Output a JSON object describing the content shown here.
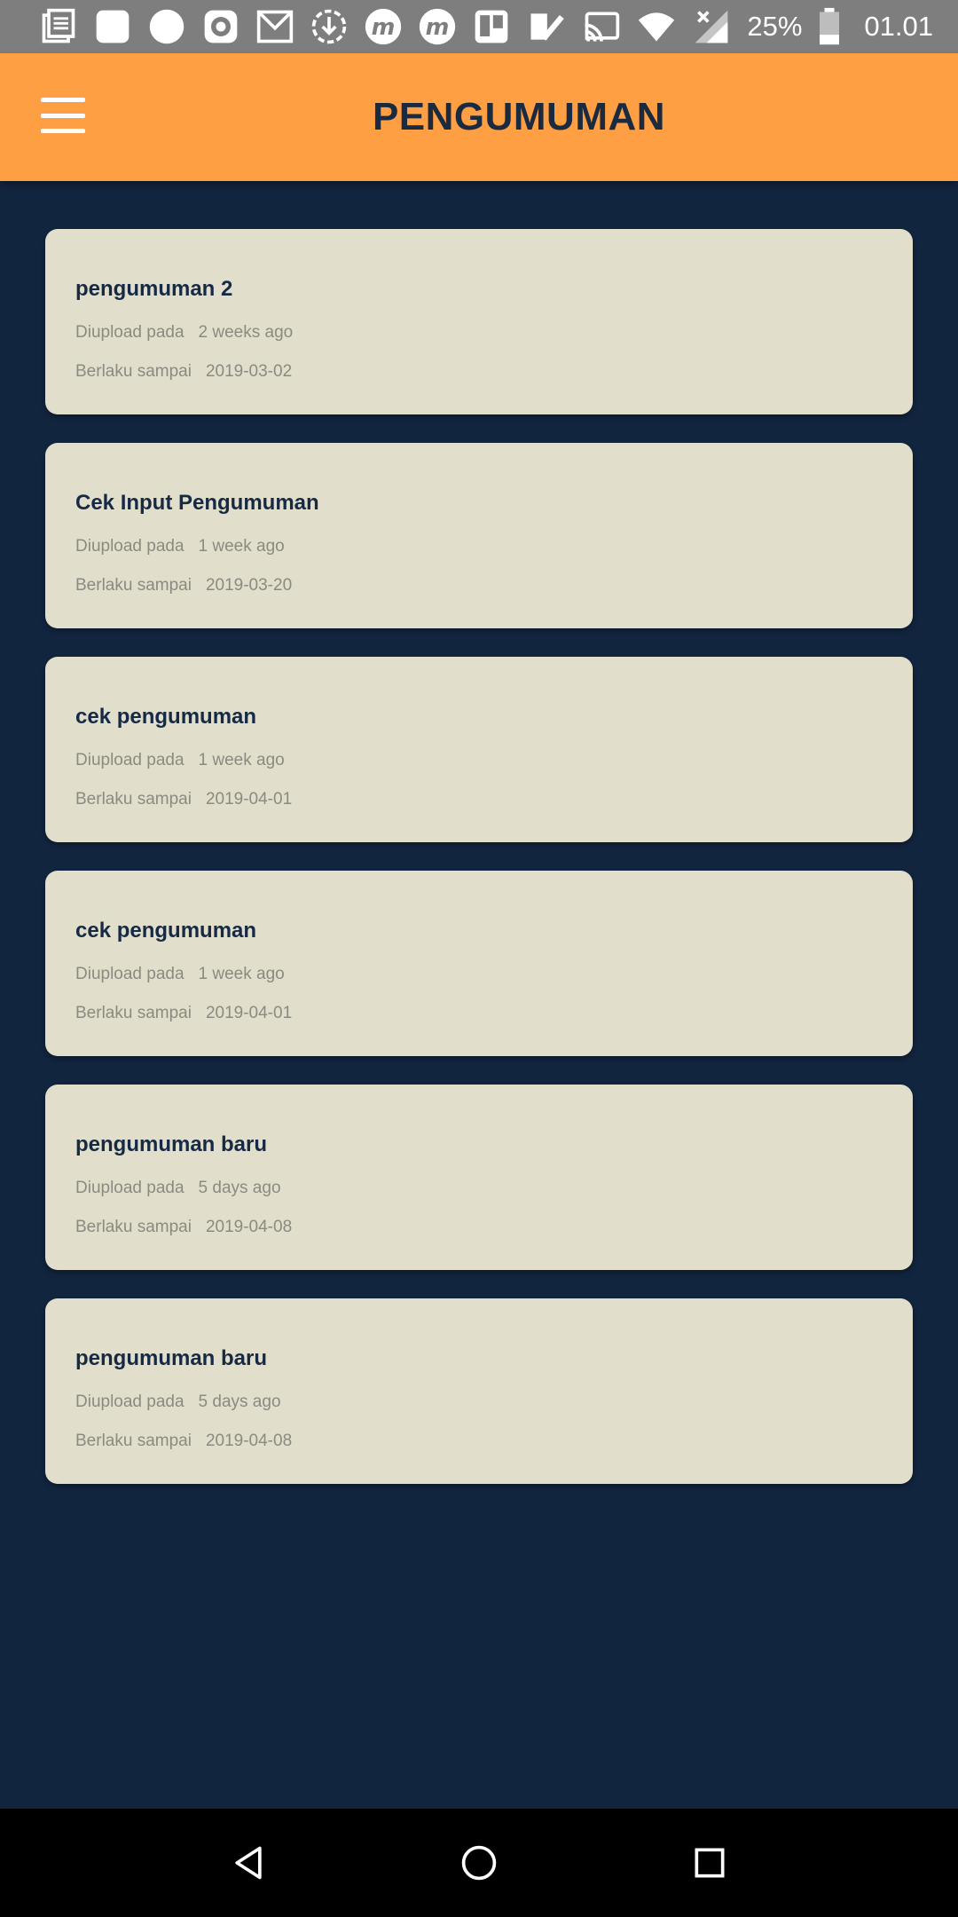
{
  "status_bar": {
    "notification_icons": [
      "news-icon",
      "square-app-icon",
      "circle-app-icon",
      "disc-icon",
      "gmail-icon",
      "download-icon",
      "m-app-icon",
      "m-app-icon",
      "trello-icon",
      "check-app-icon"
    ],
    "battery_percent": "25%",
    "time": "01.01"
  },
  "app_bar": {
    "title": "PENGUMUMAN",
    "color": "#ff9f43"
  },
  "announcements": [
    {
      "title": "pengumuman 2",
      "uploaded_label": "Diupload pada",
      "uploaded_value": "2 weeks ago",
      "valid_label": "Berlaku sampai",
      "valid_value": "2019-03-02"
    },
    {
      "title": "Cek Input Pengumuman",
      "uploaded_label": "Diupload pada",
      "uploaded_value": "1 week ago",
      "valid_label": "Berlaku sampai",
      "valid_value": "2019-03-20"
    },
    {
      "title": "cek pengumuman",
      "uploaded_label": "Diupload pada",
      "uploaded_value": "1 week ago",
      "valid_label": "Berlaku sampai",
      "valid_value": "2019-04-01"
    },
    {
      "title": "cek pengumuman",
      "uploaded_label": "Diupload pada",
      "uploaded_value": "1 week ago",
      "valid_label": "Berlaku sampai",
      "valid_value": "2019-04-01"
    },
    {
      "title": "pengumuman baru",
      "uploaded_label": "Diupload pada",
      "uploaded_value": "5 days ago",
      "valid_label": "Berlaku sampai",
      "valid_value": "2019-04-08"
    },
    {
      "title": "pengumuman baru",
      "uploaded_label": "Diupload pada",
      "uploaded_value": "5 days ago",
      "valid_label": "Berlaku sampai",
      "valid_value": "2019-04-08"
    }
  ],
  "colors": {
    "background": "#12253f",
    "card": "#e1dfcb",
    "title_text": "#172a45"
  }
}
